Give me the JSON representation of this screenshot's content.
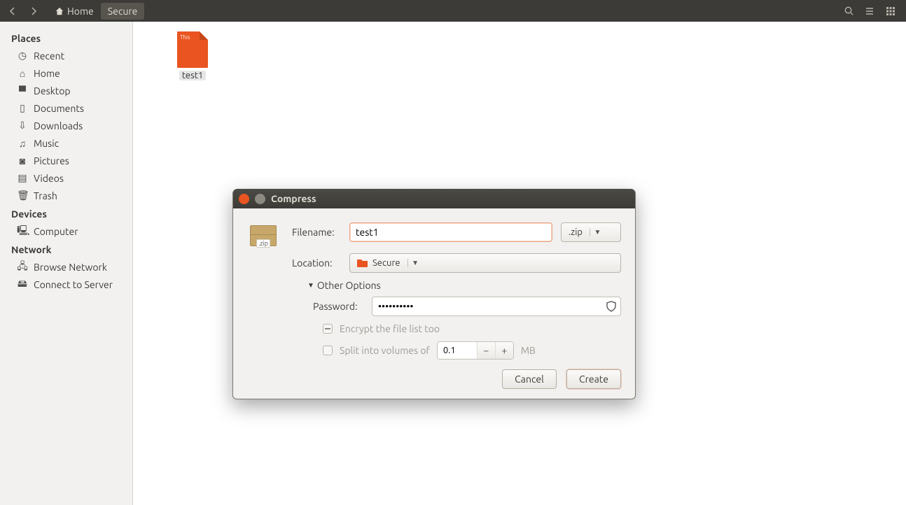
{
  "toolbar": {
    "breadcrumb": {
      "home": "Home",
      "current": "Secure"
    }
  },
  "sidebar": {
    "sections": {
      "places": "Places",
      "devices": "Devices",
      "network": "Network"
    },
    "places": [
      {
        "label": "Recent"
      },
      {
        "label": "Home"
      },
      {
        "label": "Desktop"
      },
      {
        "label": "Documents"
      },
      {
        "label": "Downloads"
      },
      {
        "label": "Music"
      },
      {
        "label": "Pictures"
      },
      {
        "label": "Videos"
      },
      {
        "label": "Trash"
      }
    ],
    "devices": [
      {
        "label": "Computer"
      }
    ],
    "network": [
      {
        "label": "Browse Network"
      },
      {
        "label": "Connect to Server"
      }
    ]
  },
  "content": {
    "file": {
      "label": "test1",
      "icon_text": "This"
    }
  },
  "dialog": {
    "title": "Compress",
    "pkg_ext_label": ".zip",
    "filename_label": "Filename:",
    "filename_value": "test1",
    "ext": ".zip",
    "location_label": "Location:",
    "location_value": "Secure",
    "expander": "Other Options",
    "password_label": "Password:",
    "password_value": "0000000000",
    "encrypt_label": "Encrypt the file list too",
    "split_label": "Split into volumes of",
    "split_value": "0.1",
    "split_unit": "MB",
    "cancel": "Cancel",
    "create": "Create"
  }
}
